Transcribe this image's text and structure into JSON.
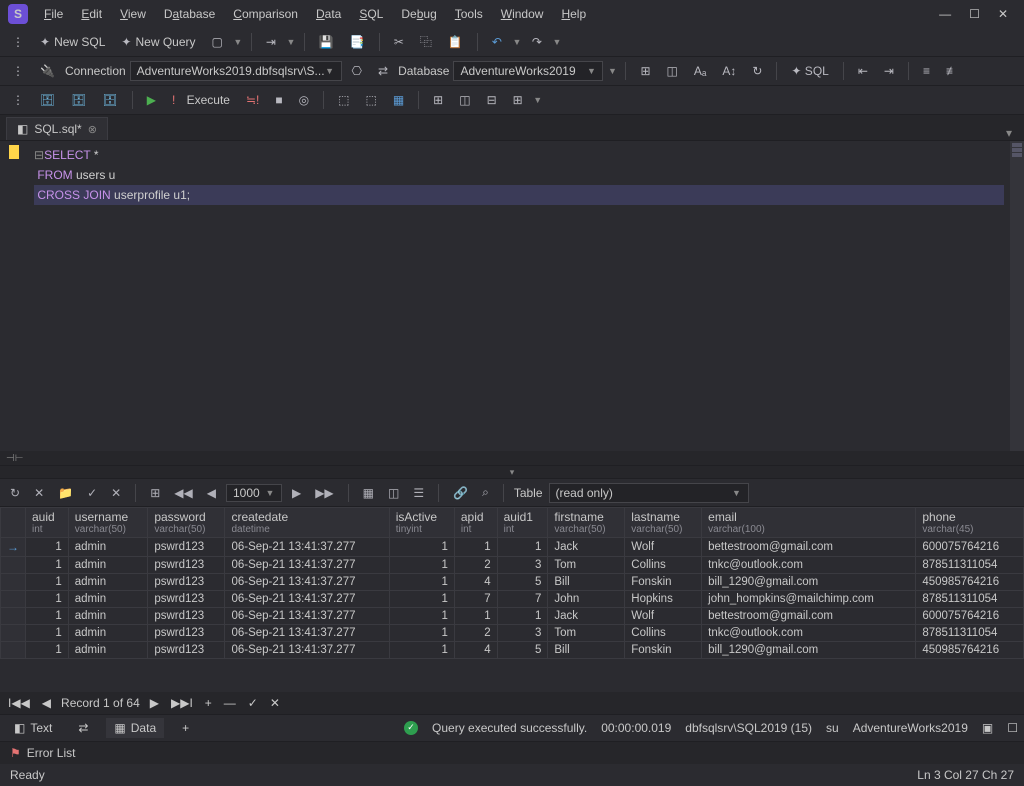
{
  "titlebar": {
    "logo_letter": "S"
  },
  "menu": [
    "File",
    "Edit",
    "View",
    "Database",
    "Comparison",
    "Data",
    "SQL",
    "Debug",
    "Tools",
    "Window",
    "Help"
  ],
  "toolbar1": {
    "new_sql": "New SQL",
    "new_query": "New Query"
  },
  "toolbar2": {
    "connection_label": "Connection",
    "connection_value": "AdventureWorks2019.dbfsqlsrv\\S...",
    "database_label": "Database",
    "database_value": "AdventureWorks2019"
  },
  "toolbar3": {
    "execute": "Execute"
  },
  "tab": {
    "name": "SQL.sql*"
  },
  "code": {
    "l1_kw": "SELECT",
    "l1_rest": " *",
    "l2_kw": "FROM",
    "l2_rest": " users u",
    "l3_kw1": "CROSS",
    "l3_kw2": "JOIN",
    "l3_rest": " userprofile u1;"
  },
  "results_toolbar": {
    "page_size": "1000",
    "table_label": "Table",
    "mode": "(read only)"
  },
  "columns": [
    {
      "name": "auid",
      "type": "int"
    },
    {
      "name": "username",
      "type": "varchar(50)"
    },
    {
      "name": "password",
      "type": "varchar(50)"
    },
    {
      "name": "createdate",
      "type": "datetime"
    },
    {
      "name": "isActive",
      "type": "tinyint"
    },
    {
      "name": "apid",
      "type": "int"
    },
    {
      "name": "auid1",
      "type": "int"
    },
    {
      "name": "firstname",
      "type": "varchar(50)"
    },
    {
      "name": "lastname",
      "type": "varchar(50)"
    },
    {
      "name": "email",
      "type": "varchar(100)"
    },
    {
      "name": "phone",
      "type": "varchar(45)"
    }
  ],
  "rows": [
    {
      "auid": "1",
      "username": "admin",
      "password": "pswrd123",
      "createdate": "06-Sep-21 13:41:37.277",
      "isActive": "1",
      "apid": "1",
      "auid1": "1",
      "firstname": "Jack",
      "lastname": "Wolf",
      "email": "bettestroom@gmail.com",
      "phone": "600075764216"
    },
    {
      "auid": "1",
      "username": "admin",
      "password": "pswrd123",
      "createdate": "06-Sep-21 13:41:37.277",
      "isActive": "1",
      "apid": "2",
      "auid1": "3",
      "firstname": "Tom",
      "lastname": "Collins",
      "email": "tnkc@outlook.com",
      "phone": "878511311054"
    },
    {
      "auid": "1",
      "username": "admin",
      "password": "pswrd123",
      "createdate": "06-Sep-21 13:41:37.277",
      "isActive": "1",
      "apid": "4",
      "auid1": "5",
      "firstname": "Bill",
      "lastname": "Fonskin",
      "email": "bill_1290@gmail.com",
      "phone": "450985764216"
    },
    {
      "auid": "1",
      "username": "admin",
      "password": "pswrd123",
      "createdate": "06-Sep-21 13:41:37.277",
      "isActive": "1",
      "apid": "7",
      "auid1": "7",
      "firstname": "John",
      "lastname": "Hopkins",
      "email": "john_hompkins@mailchimp.com",
      "phone": "878511311054"
    },
    {
      "auid": "1",
      "username": "admin",
      "password": "pswrd123",
      "createdate": "06-Sep-21 13:41:37.277",
      "isActive": "1",
      "apid": "1",
      "auid1": "1",
      "firstname": "Jack",
      "lastname": "Wolf",
      "email": "bettestroom@gmail.com",
      "phone": "600075764216"
    },
    {
      "auid": "1",
      "username": "admin",
      "password": "pswrd123",
      "createdate": "06-Sep-21 13:41:37.277",
      "isActive": "1",
      "apid": "2",
      "auid1": "3",
      "firstname": "Tom",
      "lastname": "Collins",
      "email": "tnkc@outlook.com",
      "phone": "878511311054"
    },
    {
      "auid": "1",
      "username": "admin",
      "password": "pswrd123",
      "createdate": "06-Sep-21 13:41:37.277",
      "isActive": "1",
      "apid": "4",
      "auid1": "5",
      "firstname": "Bill",
      "lastname": "Fonskin",
      "email": "bill_1290@gmail.com",
      "phone": "450985764216"
    }
  ],
  "grid_footer": {
    "record": "Record 1 of 64"
  },
  "bottom_tabs": {
    "text": "Text",
    "data": "Data"
  },
  "status_strip": {
    "exec_msg": "Query executed successfully.",
    "time": "00:00:00.019",
    "server": "dbfsqlsrv\\SQL2019 (15)",
    "user": "su",
    "db": "AdventureWorks2019"
  },
  "errorlist_label": "Error List",
  "statusbar": {
    "ready": "Ready",
    "pos": "Ln 3   Col 27   Ch 27"
  }
}
